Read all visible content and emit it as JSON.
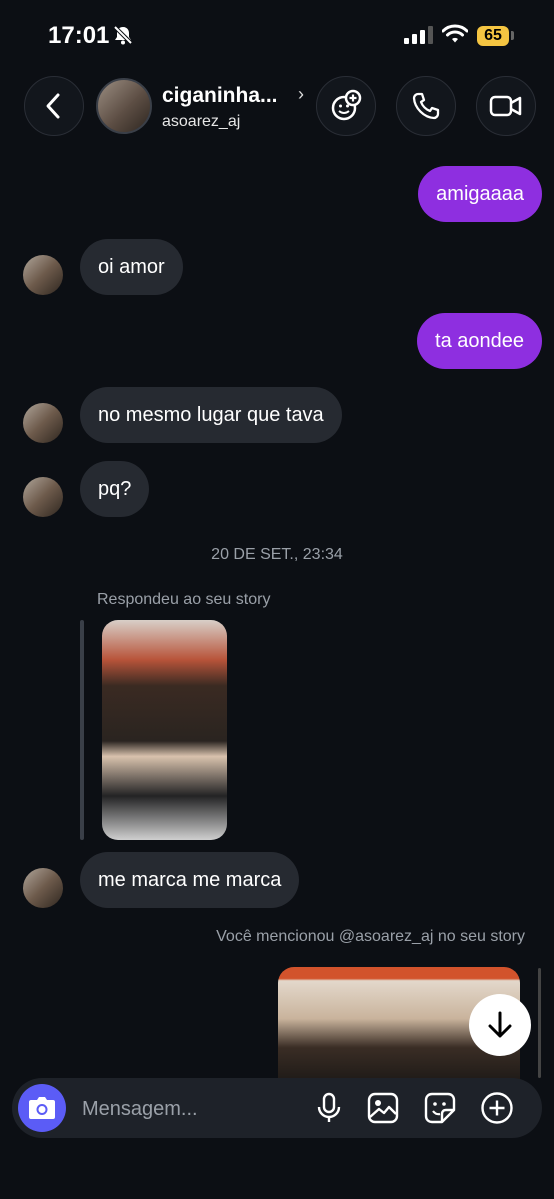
{
  "status": {
    "time": "17:01",
    "battery": "65"
  },
  "header": {
    "name": "ciganinha...",
    "username": "asoarez_aj"
  },
  "messages": [
    {
      "text": "amigaaaa",
      "dir": "sent"
    },
    {
      "text": "oi amor",
      "dir": "received"
    },
    {
      "text": "ta aondee",
      "dir": "sent"
    },
    {
      "text": "no mesmo lugar que tava",
      "dir": "received"
    },
    {
      "text": "pq?",
      "dir": "received"
    },
    {
      "text": "me marca me marca",
      "dir": "received"
    }
  ],
  "timestamp": "20 DE SET., 23:34",
  "story_reply_label": "Respondeu ao seu story",
  "mention_label": "Você mencionou @asoarez_aj no seu story",
  "composer": {
    "placeholder": "Mensagem..."
  },
  "colors": {
    "sent_bubble": "#8e2fe0",
    "received_bubble": "#262a31",
    "camera_button": "#5b5cf6",
    "background": "#0c0f14"
  },
  "icons": [
    "chevron-left-icon",
    "effects-icon",
    "phone-icon",
    "video-icon",
    "camera-icon",
    "microphone-icon",
    "image-icon",
    "sticker-icon",
    "plus-icon",
    "arrow-down-icon",
    "bell-off-icon",
    "signal-icon",
    "wifi-icon"
  ]
}
